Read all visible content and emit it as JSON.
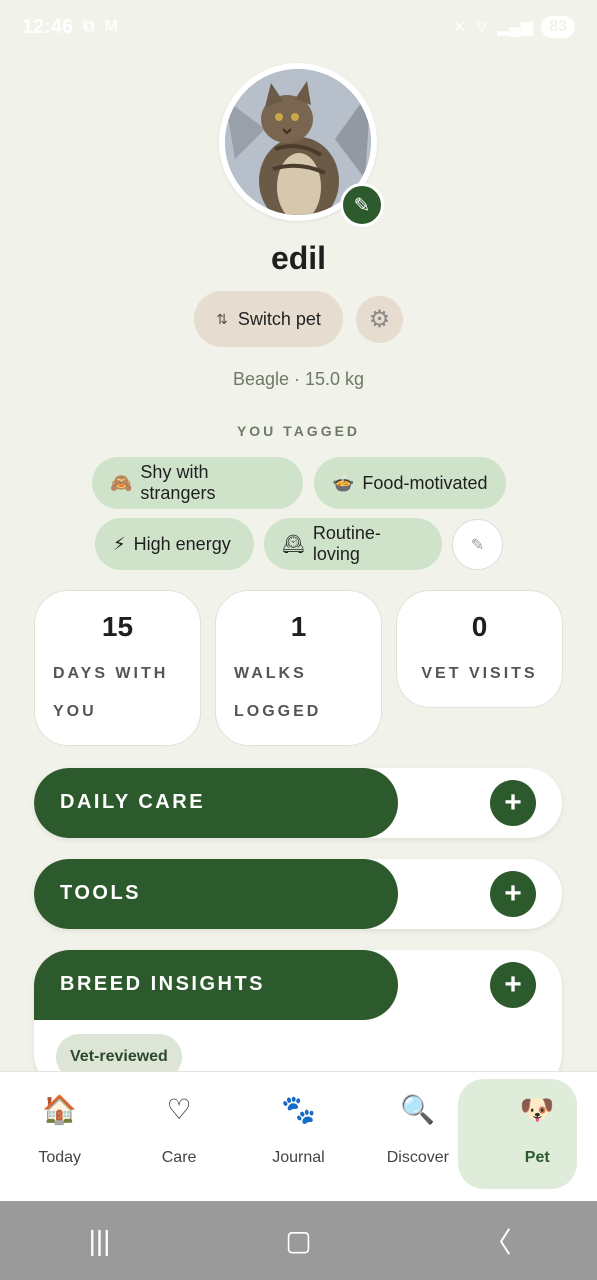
{
  "status_bar": {
    "time": "12:46",
    "battery": "83",
    "left_icons": [
      "screenshot-icon",
      "gmail-icon"
    ],
    "right_icons": [
      "mute-icon",
      "wifi-icon",
      "signal-icon"
    ]
  },
  "profile": {
    "name": "edil",
    "switch_label": "Switch pet",
    "breed_line": "Beagle · 15.0 kg",
    "tagged_heading": "YOU TAGGED",
    "tags": [
      {
        "emoji": "🙈",
        "label": "Shy with strangers"
      },
      {
        "emoji": "🍲",
        "label": "Food-motivated"
      },
      {
        "emoji": "⚡",
        "label": "High energy"
      },
      {
        "emoji": "🕰",
        "label": "Routine-loving"
      }
    ]
  },
  "stats": [
    {
      "value": "15",
      "label": "DAYS WITH YOU"
    },
    {
      "value": "1",
      "label": "WALKS LOGGED"
    },
    {
      "value": "0",
      "label": "VET VISITS"
    }
  ],
  "sections": [
    {
      "title": "DAILY CARE"
    },
    {
      "title": "TOOLS"
    },
    {
      "title": "BREED INSIGHTS",
      "badge": "Vet-reviewed"
    }
  ],
  "nav": {
    "items": [
      {
        "emoji": "🏠",
        "label": "Today"
      },
      {
        "emoji": "♡",
        "label": "Care"
      },
      {
        "emoji": "🐾",
        "label": "Journal"
      },
      {
        "emoji": "🔍",
        "label": "Discover"
      },
      {
        "emoji": "🐶",
        "label": "Pet"
      }
    ],
    "active": "Pet"
  },
  "colors": {
    "primary_green": "#2d5a2d",
    "tag_green": "#cfe3cb",
    "switch_beige": "#e6ddd0",
    "background": "#f1f3ea"
  }
}
